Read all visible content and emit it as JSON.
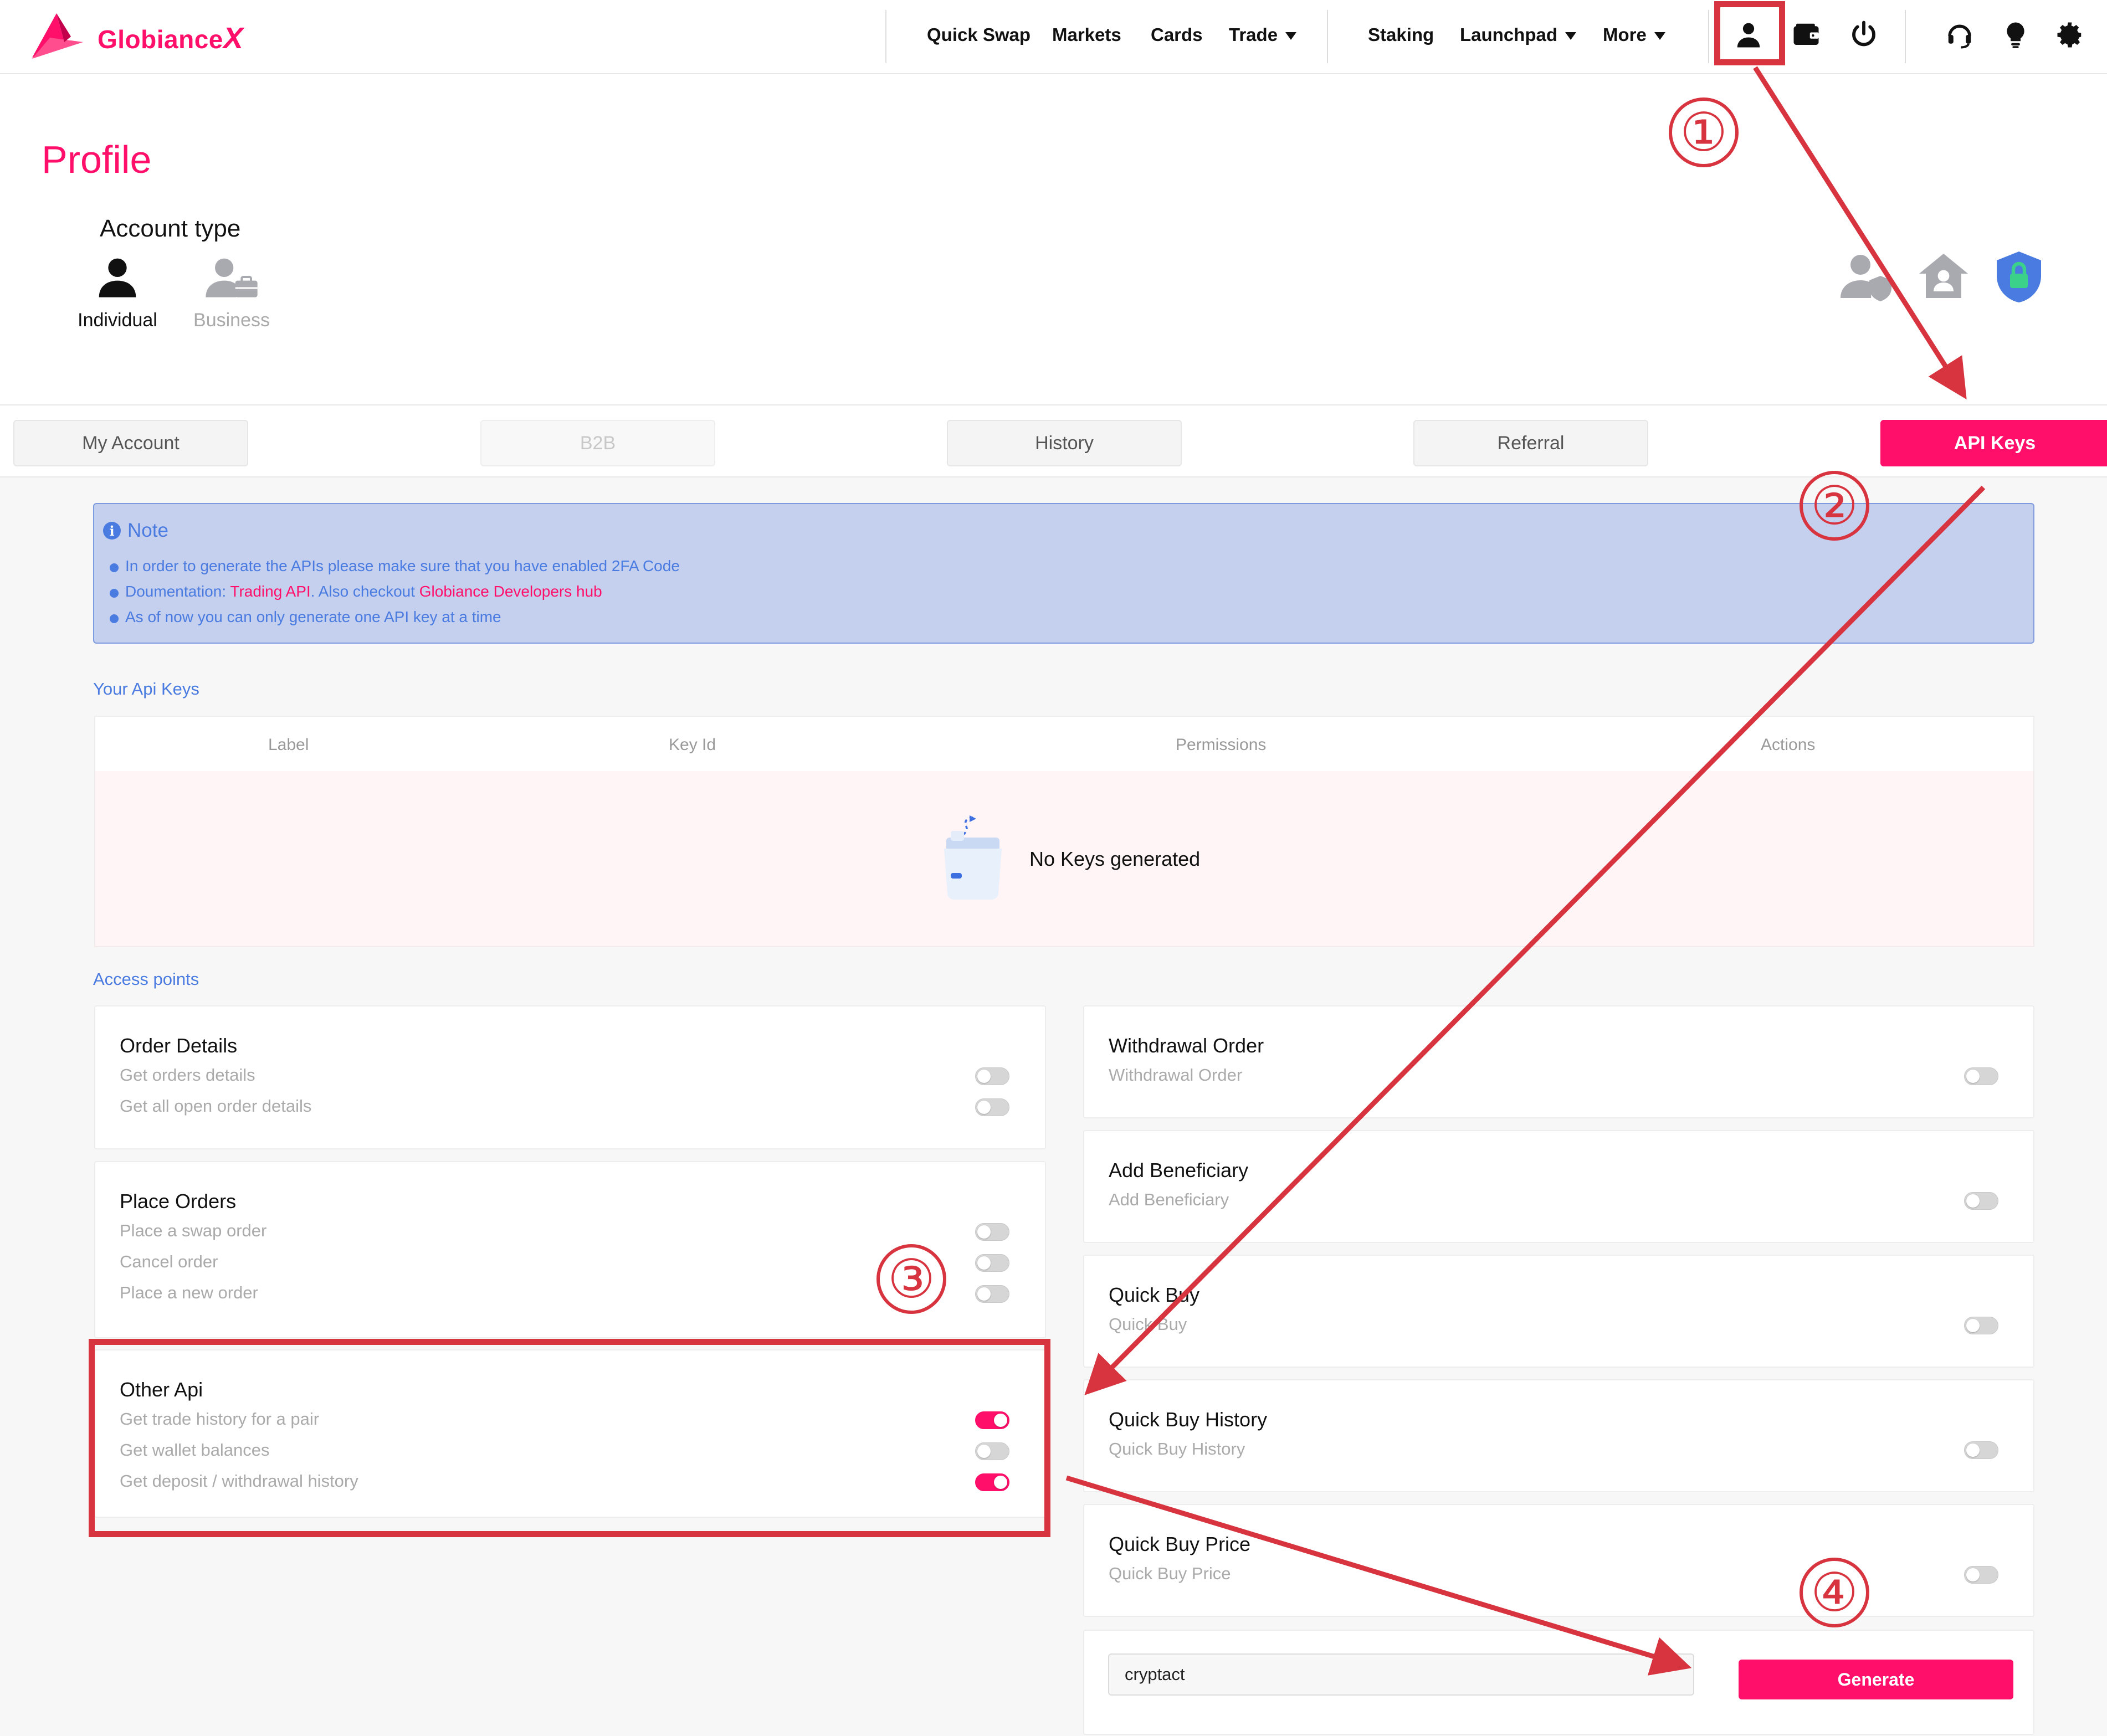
{
  "brand": {
    "name": "Globiance",
    "logo_mark": "X",
    "color": "#ff0f6a"
  },
  "nav": {
    "links": [
      {
        "label": "Quick Swap",
        "dropdown": false
      },
      {
        "label": "Markets",
        "dropdown": false
      },
      {
        "label": "Cards",
        "dropdown": false
      },
      {
        "label": "Trade",
        "dropdown": true
      },
      {
        "label": "Staking",
        "dropdown": false
      },
      {
        "label": "Launchpad",
        "dropdown": true
      },
      {
        "label": "More",
        "dropdown": true
      }
    ],
    "icons": [
      "user-icon",
      "wallet-icon",
      "power-icon",
      "headset-icon",
      "lightbulb-icon",
      "gear-icon"
    ]
  },
  "profile": {
    "title": "Profile",
    "account_type_label": "Account type",
    "options": [
      {
        "label": "Individual",
        "selected": true
      },
      {
        "label": "Business",
        "selected": false
      }
    ],
    "status_icons": [
      "user-verify-icon",
      "home-icon",
      "shield-lock-icon"
    ]
  },
  "tabs": [
    {
      "label": "My Account",
      "state": "normal"
    },
    {
      "label": "B2B",
      "state": "disabled"
    },
    {
      "label": "History",
      "state": "normal"
    },
    {
      "label": "Referral",
      "state": "normal"
    },
    {
      "label": "API Keys",
      "state": "active"
    }
  ],
  "note": {
    "title": "Note",
    "line1": "In order to generate the APIs please make sure that you have enabled 2FA Code",
    "line2_prefix": "Doumentation: ",
    "line2_link1": "Trading API",
    "line2_mid": ". Also checkout ",
    "line2_link2": "Globiance Developers hub",
    "line3": "As of now you can only generate one API key at a time"
  },
  "api_keys": {
    "section_label": "Your Api Keys",
    "columns": [
      "Label",
      "Key Id",
      "Permissions",
      "Actions"
    ],
    "rows": [],
    "empty_text": "No Keys generated"
  },
  "access_points": {
    "section_label": "Access points",
    "left": [
      {
        "title": "Order Details",
        "items": [
          {
            "label": "Get orders details",
            "enabled": false
          },
          {
            "label": "Get all open order details",
            "enabled": false
          }
        ]
      },
      {
        "title": "Place Orders",
        "items": [
          {
            "label": "Place a swap order",
            "enabled": false
          },
          {
            "label": "Cancel order",
            "enabled": false
          },
          {
            "label": "Place a new order",
            "enabled": false
          }
        ]
      },
      {
        "title": "Other Api",
        "items": [
          {
            "label": "Get trade history for a pair",
            "enabled": true
          },
          {
            "label": "Get wallet balances",
            "enabled": false
          },
          {
            "label": "Get deposit / withdrawal history",
            "enabled": true
          }
        ]
      }
    ],
    "right": [
      {
        "title": "Withdrawal Order",
        "items": [
          {
            "label": "Withdrawal Order",
            "enabled": false
          }
        ]
      },
      {
        "title": "Add Beneficiary",
        "items": [
          {
            "label": "Add Beneficiary",
            "enabled": false
          }
        ]
      },
      {
        "title": "Quick Buy",
        "items": [
          {
            "label": "Quick Buy",
            "enabled": false
          }
        ]
      },
      {
        "title": "Quick Buy History",
        "items": [
          {
            "label": "Quick Buy History",
            "enabled": false
          }
        ]
      },
      {
        "title": "Quick Buy Price",
        "items": [
          {
            "label": "Quick Buy Price",
            "enabled": false
          }
        ]
      }
    ]
  },
  "generate": {
    "label_value": "cryptact",
    "button_label": "Generate"
  },
  "annotations": {
    "step1": "①",
    "step2": "②",
    "step3": "③",
    "step4": "④",
    "color": "#d8343f"
  }
}
